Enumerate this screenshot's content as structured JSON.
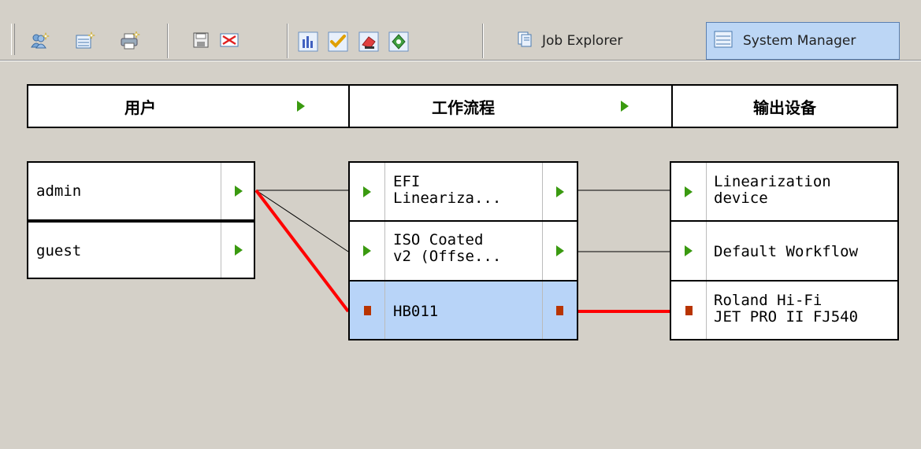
{
  "toolbar": {
    "buttons": [
      {
        "name": "add-user-icon"
      },
      {
        "name": "add-device-icon"
      },
      {
        "name": "add-printer-icon"
      },
      {
        "name": "save-icon"
      },
      {
        "name": "delete-icon"
      },
      {
        "name": "chart-icon"
      },
      {
        "name": "checkmark-icon"
      },
      {
        "name": "eraser-icon"
      },
      {
        "name": "diamond-icon"
      }
    ],
    "job_explorer_label": "Job Explorer",
    "system_manager_label": "System Manager"
  },
  "headers": {
    "users": "用户",
    "workflows": "工作流程",
    "output_devices": "输出设备"
  },
  "users": [
    {
      "label": "admin",
      "status": "active"
    },
    {
      "label": "guest",
      "status": "active"
    }
  ],
  "workflows": [
    {
      "label": "EFI\nLineariza...",
      "status": "active",
      "selected": false
    },
    {
      "label": "ISO Coated\nv2 (Offse...",
      "status": "active",
      "selected": false
    },
    {
      "label": "HB011",
      "status": "stopped",
      "selected": true
    }
  ],
  "devices": [
    {
      "label": "Linearization\ndevice",
      "status": "active"
    },
    {
      "label": "Default Workflow",
      "status": "active"
    },
    {
      "label": "Roland Hi-Fi\nJET PRO II FJ540",
      "status": "stopped"
    }
  ],
  "colors": {
    "active_arrow": "#3a9a10",
    "stopped_square": "#b83400",
    "selected_bg": "#b8d4f8",
    "highlight_link": "#ff0000",
    "nav_active_bg": "#bcd6f5"
  }
}
